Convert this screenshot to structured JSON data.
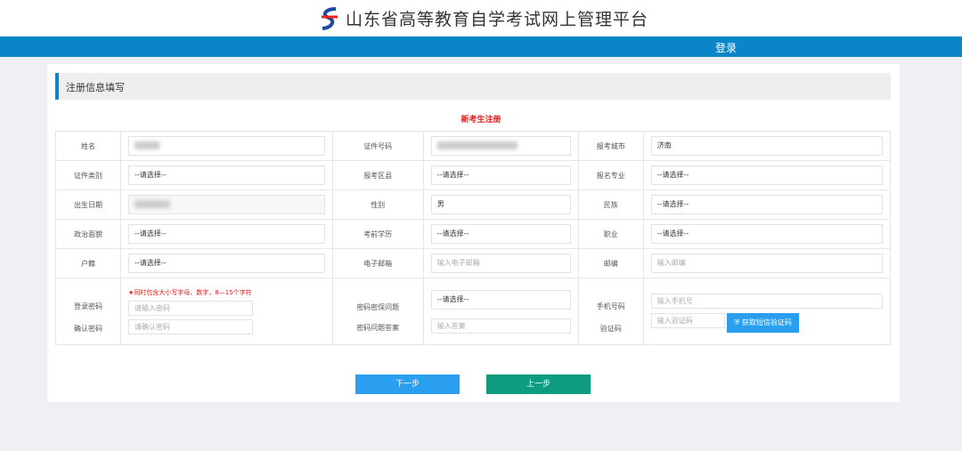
{
  "header": {
    "title": "山东省高等教育自学考试网上管理平台",
    "login": "登录"
  },
  "section": {
    "title": "注册信息填写"
  },
  "form": {
    "title": "新考生注册",
    "name_label": "姓名",
    "id_number_label": "证件号码",
    "city_label": "报考城市",
    "city_value": "济南",
    "id_type_label": "证件类别",
    "id_type_value": "--请选择--",
    "district_label": "报考区县",
    "district_value": "--请选择--",
    "major_label": "报名专业",
    "major_value": "--请选择--",
    "birth_label": "出生日期",
    "gender_label": "性别",
    "gender_value": "男",
    "ethnic_label": "民族",
    "ethnic_value": "--请选择--",
    "political_label": "政治面貌",
    "political_value": "--请选择--",
    "education_label": "考前学历",
    "education_value": "--请选择--",
    "job_label": "职业",
    "job_value": "--请选择--",
    "hukou_label": "户籍",
    "hukou_value": "--请选择--",
    "email_label": "电子邮箱",
    "email_placeholder": "输入电子邮箱",
    "postcode_label": "邮编",
    "postcode_placeholder": "输入邮编",
    "password_hint": "★同时包含大小写字母、数字，8—15个字符",
    "password_label": "登录密码",
    "password_placeholder": "请输入密码",
    "confirm_label": "确认密码",
    "confirm_placeholder": "请确认密码",
    "question_label": "密码密保问题",
    "question_value": "--请选择--",
    "answer_label": "密码问题答案",
    "answer_placeholder": "输入答案",
    "phone_label": "手机号码",
    "phone_placeholder": "输入手机号",
    "code_label": "验证码",
    "code_placeholder": "输入验证码",
    "sms_button": "获取短信验证码"
  },
  "buttons": {
    "next": "下一步",
    "prev": "上一步"
  },
  "colors": {
    "brand": "#0a86c8",
    "next": "#2a9ff0",
    "prev": "#0e9b7f",
    "required": "#e51c1c"
  }
}
